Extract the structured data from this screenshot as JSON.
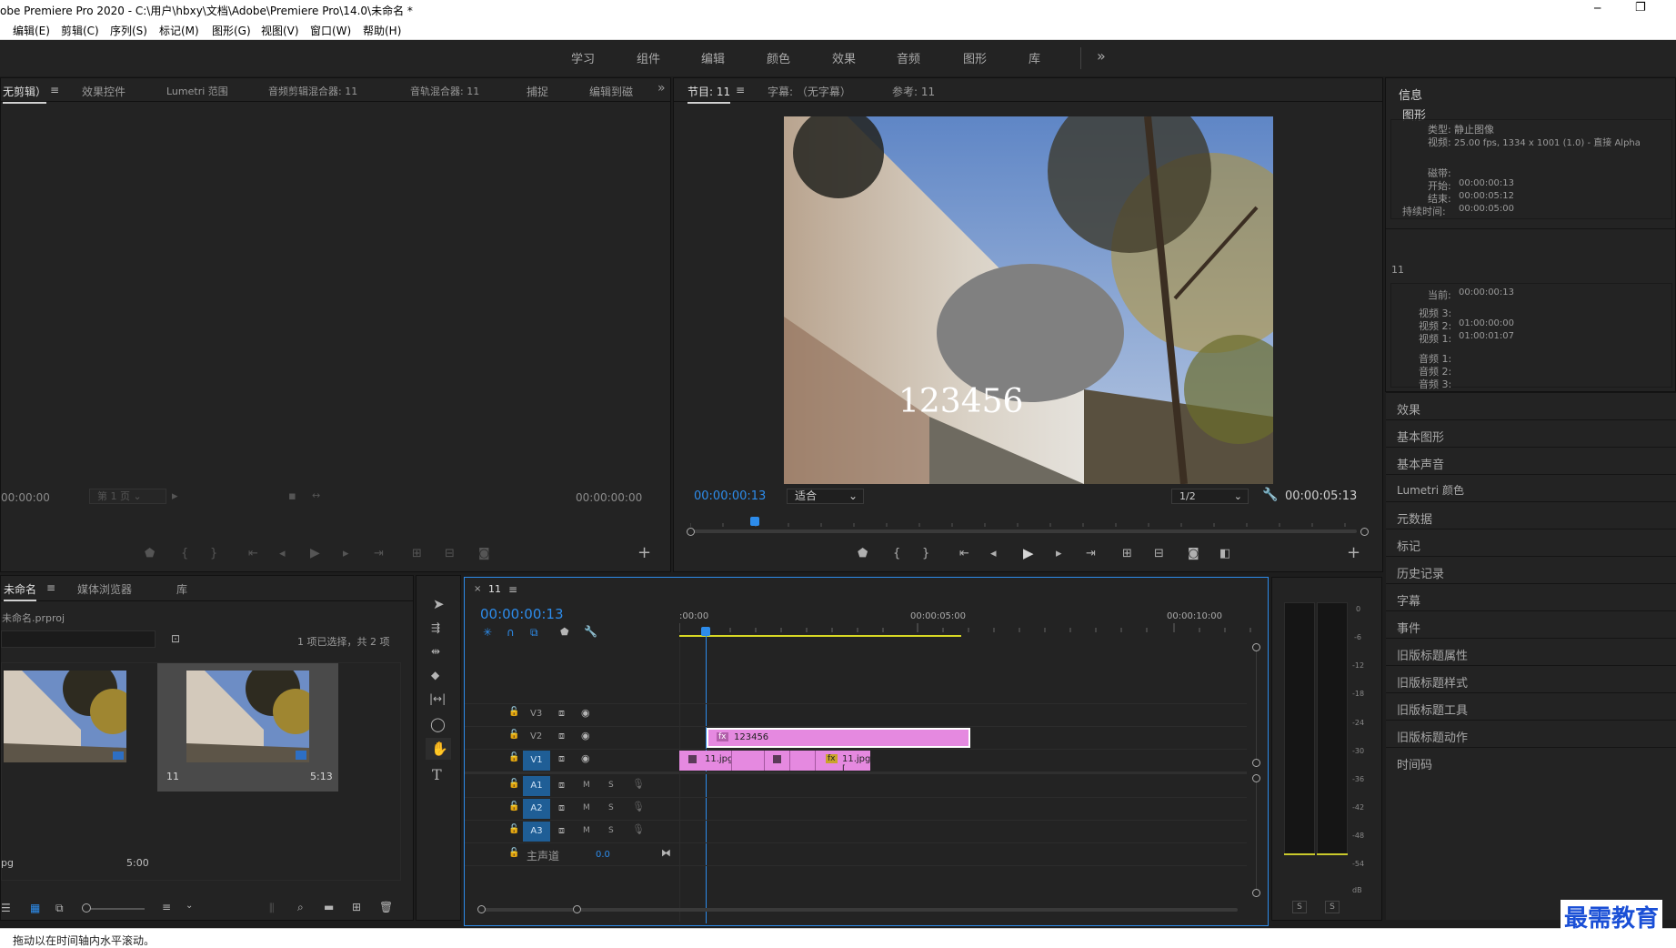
{
  "titlebar": {
    "title": "obe Premiere Pro 2020 - C:\\用户\\hbxy\\文档\\Adobe\\Premiere Pro\\14.0\\未命名 *",
    "minimize": "─",
    "restore": "❐"
  },
  "menu": [
    "编辑(E)",
    "剪辑(C)",
    "序列(S)",
    "标记(M)",
    "图形(G)",
    "视图(V)",
    "窗口(W)",
    "帮助(H)"
  ],
  "workspaces": [
    "学习",
    "组件",
    "编辑",
    "颜色",
    "效果",
    "音频",
    "图形",
    "库"
  ],
  "workspace_more": "»",
  "source_panel": {
    "tabs": [
      "无剪辑）",
      "效果控件",
      "Lumetri 范围",
      "音频剪辑混合器: 11",
      "音轨混合器: 11",
      "捕捉",
      "编辑到磁"
    ],
    "more": "»",
    "timecode_left": "00:00:00",
    "page_select": "第 1 页",
    "timecode_right": "00:00:00:00"
  },
  "program_panel": {
    "tabs": [
      "节目: 11",
      "字幕: （无字幕）",
      "参考: 11"
    ],
    "overlay_text": "123456",
    "timecode": "00:00:00:13",
    "fit": "适合",
    "resolution": "1/2",
    "duration": "00:00:05:13"
  },
  "project_panel": {
    "tabs": [
      "未命名",
      "媒体浏览器",
      "库"
    ],
    "filename": "未命名.prproj",
    "selection": "1 项已选择，共 2 项",
    "items": [
      {
        "name": "pg",
        "duration": "5:00"
      },
      {
        "name": "11",
        "duration": "5:13"
      }
    ]
  },
  "timeline": {
    "tab": "11",
    "timecode": "00:00:00:13",
    "ruler": [
      ":00:00",
      "00:00:05:00",
      "00:00:10:00"
    ],
    "tracks": [
      {
        "id": "V3",
        "type": "video"
      },
      {
        "id": "V2",
        "type": "video"
      },
      {
        "id": "V1",
        "type": "video"
      },
      {
        "id": "A1",
        "type": "audio"
      },
      {
        "id": "A2",
        "type": "audio"
      },
      {
        "id": "A3",
        "type": "audio"
      }
    ],
    "master_label": "主声道",
    "master_value": "0.0",
    "clip_v2": "123456",
    "clip_v1a": "11.jpg",
    "clip_v1b": "11.jpg [",
    "fx": "fx",
    "mute": "M",
    "solo": "S"
  },
  "audio_meter": {
    "scale": [
      "0",
      "-6",
      "-12",
      "-18",
      "-24",
      "-30",
      "-36",
      "-42",
      "-48",
      "-54",
      "dB"
    ],
    "solo_left": "S",
    "solo_right": "S"
  },
  "info_panel": {
    "title": "信息",
    "section": "图形",
    "type_label": "类型:",
    "type_value": "静止图像",
    "video_label": "视频:",
    "video_value": "25.00 fps, 1334 x 1001 (1.0) - 直接 Alpha",
    "tape_label": "磁带:",
    "start_label": "开始:",
    "start_value": "00:00:00:13",
    "end_label": "结束:",
    "end_value": "00:00:05:12",
    "dur_label": "持续时间:",
    "dur_value": "00:00:05:00",
    "seq_name": "11",
    "current_label": "当前:",
    "current_value": "00:00:00:13",
    "v3_label": "视频 3:",
    "v2_label": "视频 2:",
    "v2_value": "01:00:00:00",
    "v1_label": "视频 1:",
    "v1_value": "01:00:01:07",
    "a1_label": "音频 1:",
    "a2_label": "音频 2:",
    "a3_label": "音频 3:"
  },
  "right_panels": [
    "效果",
    "基本图形",
    "基本声音",
    "Lumetri 颜色",
    "元数据",
    "标记",
    "历史记录",
    "字幕",
    "事件",
    "旧版标题属性",
    "旧版标题样式",
    "旧版标题工具",
    "旧版标题动作",
    "时间码"
  ],
  "status": "拖动以在时间轴内水平滚动。",
  "watermark": "最需教育"
}
